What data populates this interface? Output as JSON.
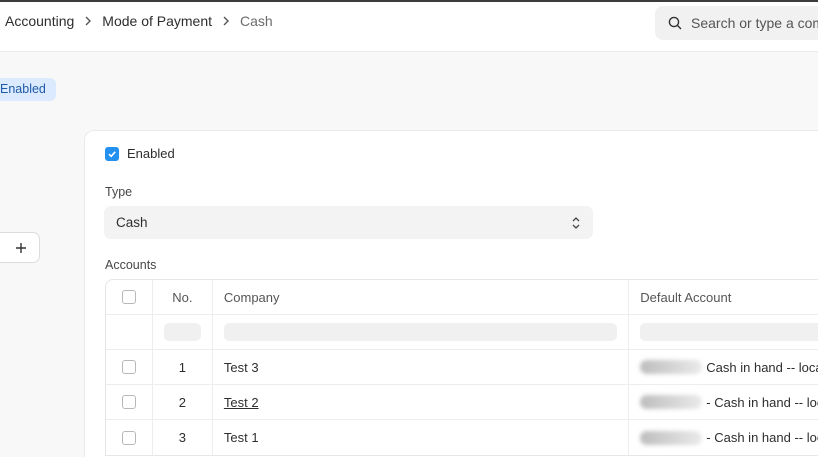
{
  "breadcrumb": {
    "items": [
      "Accounting",
      "Mode of Payment"
    ],
    "current": "Cash"
  },
  "search": {
    "placeholder": "Search or type a command"
  },
  "status": {
    "label": "Enabled"
  },
  "form": {
    "enabled_label": "Enabled",
    "enabled_checked": true,
    "type_label": "Type",
    "type_value": "Cash",
    "accounts_label": "Accounts"
  },
  "table": {
    "columns": [
      "No.",
      "Company",
      "Default Account"
    ],
    "rows": [
      {
        "no": "1",
        "company": "Test 3",
        "account_suffix": "Cash in hand -- loca"
      },
      {
        "no": "2",
        "company": "Test 2",
        "account_suffix": "- Cash in hand -- loca"
      },
      {
        "no": "3",
        "company": "Test 1",
        "account_suffix": "- Cash in hand -- loca"
      }
    ]
  },
  "colors": {
    "accent": "#2490ef",
    "pill_bg": "#dbeafe",
    "pill_text": "#1e5aa8"
  }
}
